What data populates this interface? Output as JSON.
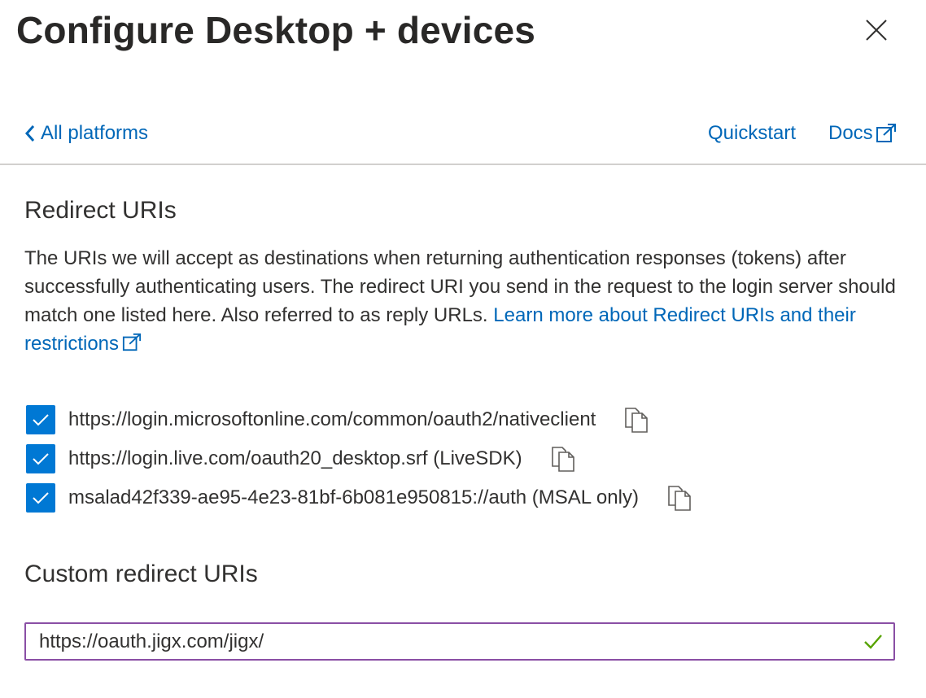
{
  "panel": {
    "title": "Configure Desktop + devices"
  },
  "nav": {
    "back_label": "All platforms",
    "quickstart_label": "Quickstart",
    "docs_label": "Docs"
  },
  "redirect": {
    "heading": "Redirect URIs",
    "description": "The URIs we will accept as destinations when returning authentication responses (tokens) after successfully authenticating users. The redirect URI you send in the request to the login server should match one listed here. Also referred to as reply URLs.",
    "learn_more_label": "Learn more about Redirect URIs and their restrictions",
    "uris": [
      {
        "value": "https://login.microsoftonline.com/common/oauth2/nativeclient",
        "checked": true
      },
      {
        "value": "https://login.live.com/oauth20_desktop.srf (LiveSDK)",
        "checked": true
      },
      {
        "value": "msalad42f339-ae95-4e23-81bf-6b081e950815://auth (MSAL only)",
        "checked": true
      }
    ]
  },
  "custom": {
    "heading": "Custom redirect URIs",
    "input_value": "https://oauth.jigx.com/jigx/"
  },
  "colors": {
    "accent": "#0078d4",
    "link": "#0067b8",
    "focus_border": "#8a4fa5",
    "valid": "#57a300"
  },
  "icons": {
    "close": "close-icon",
    "back": "chevron-left-icon",
    "external": "external-link-icon",
    "check": "checkmark-icon",
    "copy": "copy-icon",
    "valid": "checkmark-valid-icon"
  }
}
